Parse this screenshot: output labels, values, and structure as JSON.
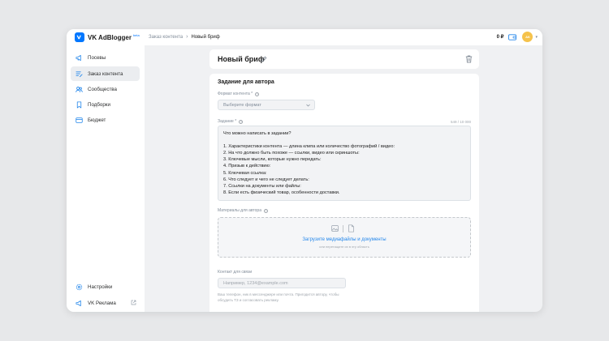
{
  "app": {
    "name": "VK AdBlogger",
    "badge": "beta"
  },
  "breadcrumb": {
    "parent": "Заказ контента",
    "separator": "›",
    "current": "Новый бриф"
  },
  "header": {
    "balance": "0 ₽",
    "avatar_initials": "AK"
  },
  "sidebar": {
    "items": [
      {
        "label": "Посевы",
        "icon": "megaphone-icon"
      },
      {
        "label": "Заказ контента",
        "icon": "edit-list-icon",
        "active": true
      },
      {
        "label": "Сообщества",
        "icon": "users-icon"
      },
      {
        "label": "Подборки",
        "icon": "bookmark-icon"
      },
      {
        "label": "Бюджет",
        "icon": "wallet-icon"
      }
    ],
    "bottom": [
      {
        "label": "Настройки",
        "icon": "gear-icon"
      },
      {
        "label": "VK Реклама",
        "icon": "megaphone-icon"
      }
    ]
  },
  "brief": {
    "title": "Новый бриф",
    "section_title": "Задание для автора",
    "format": {
      "label": "Формат контента *",
      "placeholder": "Выберите формат"
    },
    "task": {
      "label": "Задание *",
      "counter": "549 / 10 000",
      "lines": [
        "Что можно написать в задании?",
        "",
        "1. Характеристики контента — длина клипа или количество фотографий / видео:",
        "2. На что должно быть похоже — ссылки, видео или скриншоты:",
        "3. Ключевые мысли, которые нужно передать:",
        "4. Призыв к действию:",
        "5. Ключевая ссылка:",
        "6. Что следует и чего не следует делать:",
        "7. Ссылки на документы или файлы:",
        "8. Если есть физический товар, особенности доставки."
      ]
    },
    "materials": {
      "label": "Материалы для автора",
      "upload_text": "Загрузите медиафайлы и документы",
      "upload_hint": "или перетащите их в эту область"
    },
    "contact": {
      "label": "Контакт для связи",
      "placeholder": "Например, 1234@example.com",
      "hint": "Ваш телефон, ник в мессенджере или почта. Пригодится автору, чтобы обсудить ТЗ и согласовать рекламу."
    }
  },
  "colors": {
    "accent": "#0077ff",
    "link": "#2688eb",
    "avatar": "#f5c24b"
  }
}
